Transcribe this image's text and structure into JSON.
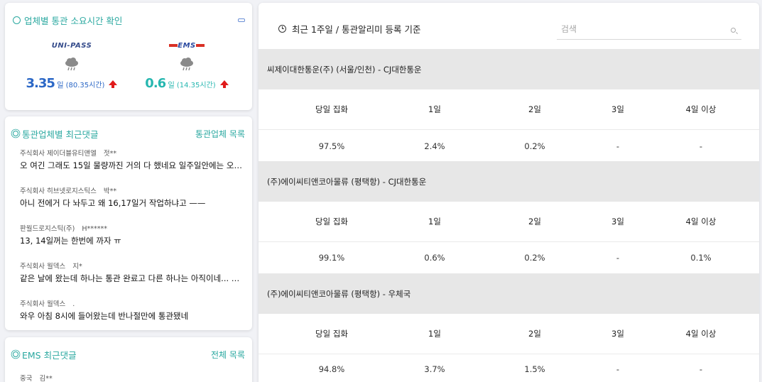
{
  "time_card": {
    "title": "업체별 통관 소요시간 확인",
    "providers": [
      {
        "logo": "UNI-PASS",
        "value": "3.35",
        "unit": "일",
        "sub": "(80.35시간)",
        "trend": "up"
      },
      {
        "logo": "EMS",
        "value": "0.6",
        "unit": "일",
        "sub": "(14.35시간)",
        "trend": "up"
      }
    ]
  },
  "comments_card": {
    "title": "통관업체별 최근댓글",
    "link": "통관업체 목록",
    "items": [
      {
        "company": "주식회사 제이더블유티앤엘",
        "user": "젓**",
        "text": "오 여긴 그래도 15일 물량까진 거의 다 했네요 일주일안에는 오…"
      },
      {
        "company": "주식회사 히브넷로지스틱스",
        "user": "박**",
        "text": "아니 전에거 다 놔두고 왜 16,17일거 작업하냐고 ——"
      },
      {
        "company": "판월드로지스틱(주)",
        "user": "H******",
        "text": "13, 14일꺼는 한번에 까자 ㅠ"
      },
      {
        "company": "주식회사 월덱스",
        "user": "지*",
        "text": "같은 날에 왔는데 하나는 통관 완료고 다른 하나는 아직이네... …"
      },
      {
        "company": "주식회사 월덱스",
        "user": ".",
        "text": "와우 아침 8시에 들어왔는데 반나절만에 통관됐네"
      }
    ]
  },
  "ems_card": {
    "title": "EMS 최근댓글",
    "link": "전체 목록",
    "items": [
      {
        "company": "중국",
        "user": "김**"
      }
    ]
  },
  "main": {
    "title": "최근 1주일 / 통관알리미 등록 기준",
    "search": {
      "placeholder": "검색",
      "value": ""
    },
    "columns": [
      "당일 집화",
      "1일",
      "2일",
      "3일",
      "4일 이상"
    ],
    "sections": [
      {
        "name": "씨제이대한통운(주) (서울/인천) - CJ대한통운",
        "values": [
          "97.5%",
          "2.4%",
          "0.2%",
          "-",
          "-"
        ]
      },
      {
        "name": "(주)에이씨티앤코아물류 (평택항) - CJ대한통운",
        "values": [
          "99.1%",
          "0.6%",
          "0.2%",
          "-",
          "0.1%"
        ]
      },
      {
        "name": "(주)에이씨티앤코아물류 (평택항) - 우체국",
        "values": [
          "94.8%",
          "3.7%",
          "1.5%",
          "-",
          "-"
        ]
      }
    ]
  },
  "colors": {
    "accent": "#2aa8a0",
    "unipass_value": "#2b67c6",
    "ems_value": "#27b7b0",
    "trend_up": "#e01b1b",
    "section_bg": "#e7e7e7"
  }
}
